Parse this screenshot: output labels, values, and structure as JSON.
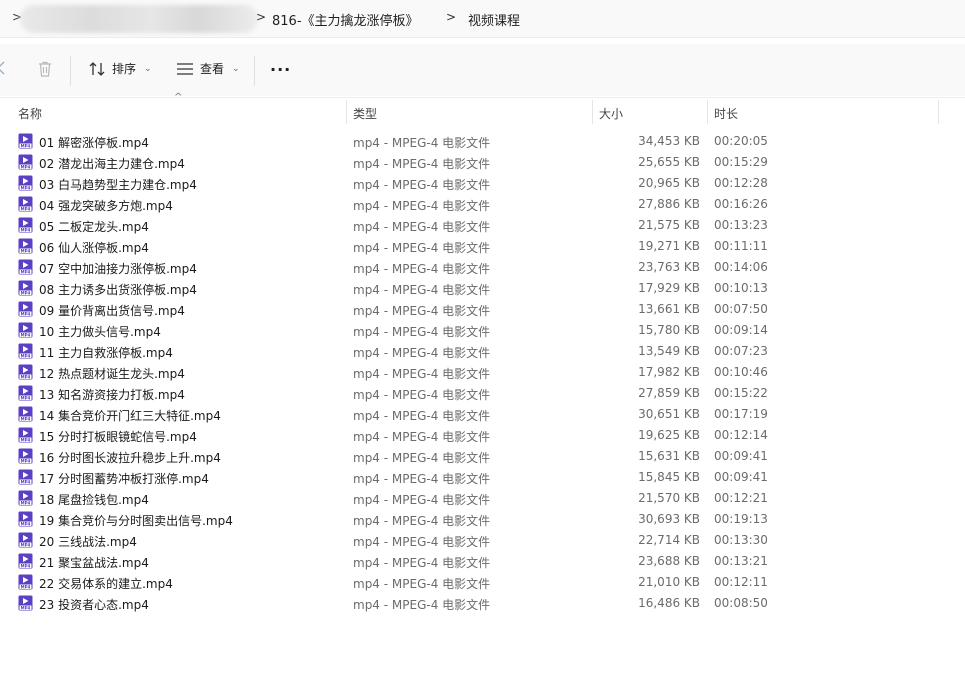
{
  "address_bar": {
    "crumbs": [
      "816-《主力擒龙涨停板》",
      "视频课程"
    ]
  },
  "toolbar": {
    "sort_label": "排序",
    "view_label": "查看",
    "more_label": "..."
  },
  "columns": {
    "name": "名称",
    "type": "类型",
    "size": "大小",
    "duration": "时长"
  },
  "files": [
    {
      "name": "01 解密涨停板.mp4",
      "type": "mp4 - MPEG-4 电影文件",
      "size": "34,453 KB",
      "duration": "00:20:05"
    },
    {
      "name": "02 潜龙出海主力建仓.mp4",
      "type": "mp4 - MPEG-4 电影文件",
      "size": "25,655 KB",
      "duration": "00:15:29"
    },
    {
      "name": "03 白马趋势型主力建仓.mp4",
      "type": "mp4 - MPEG-4 电影文件",
      "size": "20,965 KB",
      "duration": "00:12:28"
    },
    {
      "name": "04 强龙突破多方炮.mp4",
      "type": "mp4 - MPEG-4 电影文件",
      "size": "27,886 KB",
      "duration": "00:16:26"
    },
    {
      "name": "05 二板定龙头.mp4",
      "type": "mp4 - MPEG-4 电影文件",
      "size": "21,575 KB",
      "duration": "00:13:23"
    },
    {
      "name": "06 仙人涨停板.mp4",
      "type": "mp4 - MPEG-4 电影文件",
      "size": "19,271 KB",
      "duration": "00:11:11"
    },
    {
      "name": "07 空中加油接力涨停板.mp4",
      "type": "mp4 - MPEG-4 电影文件",
      "size": "23,763 KB",
      "duration": "00:14:06"
    },
    {
      "name": "08 主力诱多出货涨停板.mp4",
      "type": "mp4 - MPEG-4 电影文件",
      "size": "17,929 KB",
      "duration": "00:10:13"
    },
    {
      "name": "09 量价背离出货信号.mp4",
      "type": "mp4 - MPEG-4 电影文件",
      "size": "13,661 KB",
      "duration": "00:07:50"
    },
    {
      "name": "10 主力做头信号.mp4",
      "type": "mp4 - MPEG-4 电影文件",
      "size": "15,780 KB",
      "duration": "00:09:14"
    },
    {
      "name": "11 主力自救涨停板.mp4",
      "type": "mp4 - MPEG-4 电影文件",
      "size": "13,549 KB",
      "duration": "00:07:23"
    },
    {
      "name": "12 热点题材诞生龙头.mp4",
      "type": "mp4 - MPEG-4 电影文件",
      "size": "17,982 KB",
      "duration": "00:10:46"
    },
    {
      "name": "13 知名游资接力打板.mp4",
      "type": "mp4 - MPEG-4 电影文件",
      "size": "27,859 KB",
      "duration": "00:15:22"
    },
    {
      "name": "14 集合竞价开门红三大特征.mp4",
      "type": "mp4 - MPEG-4 电影文件",
      "size": "30,651 KB",
      "duration": "00:17:19"
    },
    {
      "name": "15 分时打板眼镜蛇信号.mp4",
      "type": "mp4 - MPEG-4 电影文件",
      "size": "19,625 KB",
      "duration": "00:12:14"
    },
    {
      "name": "16 分时图长波拉升稳步上升.mp4",
      "type": "mp4 - MPEG-4 电影文件",
      "size": "15,631 KB",
      "duration": "00:09:41"
    },
    {
      "name": "17 分时图蓄势冲板打涨停.mp4",
      "type": "mp4 - MPEG-4 电影文件",
      "size": "15,845 KB",
      "duration": "00:09:41"
    },
    {
      "name": "18 尾盘捡钱包.mp4",
      "type": "mp4 - MPEG-4 电影文件",
      "size": "21,570 KB",
      "duration": "00:12:21"
    },
    {
      "name": "19 集合竞价与分时图卖出信号.mp4",
      "type": "mp4 - MPEG-4 电影文件",
      "size": "30,693 KB",
      "duration": "00:19:13"
    },
    {
      "name": "20 三线战法.mp4",
      "type": "mp4 - MPEG-4 电影文件",
      "size": "22,714 KB",
      "duration": "00:13:30"
    },
    {
      "name": "21 聚宝盆战法.mp4",
      "type": "mp4 - MPEG-4 电影文件",
      "size": "23,688 KB",
      "duration": "00:13:21"
    },
    {
      "name": "22 交易体系的建立.mp4",
      "type": "mp4 - MPEG-4 电影文件",
      "size": "21,010 KB",
      "duration": "00:12:11"
    },
    {
      "name": "23 投资者心态.mp4",
      "type": "mp4 - MPEG-4 电影文件",
      "size": "16,486 KB",
      "duration": "00:08:50"
    }
  ],
  "colors": {
    "icon_purple": "#5b3fc4"
  }
}
